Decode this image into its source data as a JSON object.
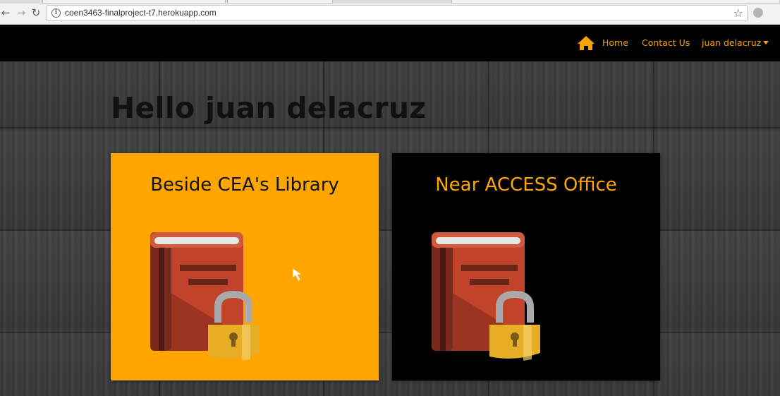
{
  "browser": {
    "url": "coen3463-finalproject-t7.herokuapp.com",
    "icons": [
      "back-icon",
      "forward-icon",
      "reload-icon",
      "info-icon",
      "star-icon",
      "extension-icon"
    ]
  },
  "nav": {
    "home_label": "Home",
    "contact_label": "Contact Us",
    "user_label": "juan delacruz",
    "accent": "#f7a400"
  },
  "main": {
    "greeting": "Hello juan delacruz",
    "cards": [
      {
        "title": "Beside CEA's Library",
        "background": "#ffa500",
        "title_color": "#111111",
        "icon": "locked-book-icon"
      },
      {
        "title": "Near ACCESS Office",
        "background": "#000000",
        "title_color": "#ffa500",
        "icon": "locked-book-icon"
      }
    ]
  }
}
